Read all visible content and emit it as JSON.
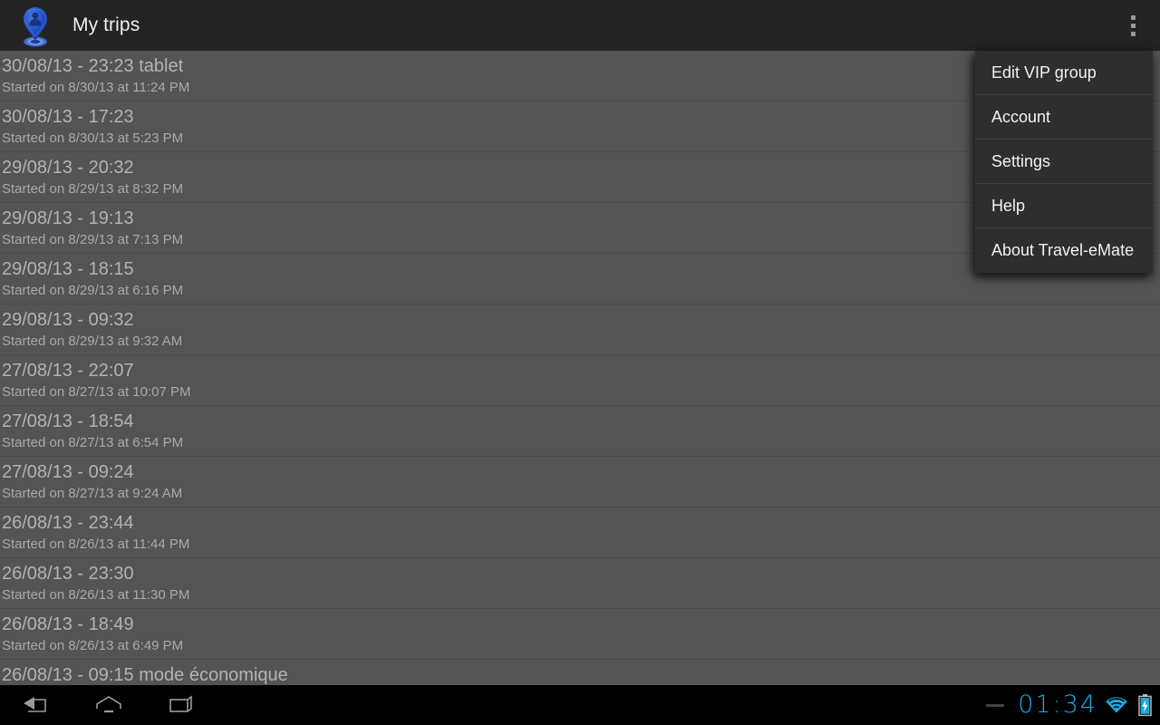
{
  "action_bar": {
    "title": "My trips",
    "app_icon": "map-pin-person-icon",
    "overflow_icon": "overflow-menu-icon"
  },
  "overflow_menu": {
    "items": [
      {
        "label": "Edit VIP group"
      },
      {
        "label": "Account"
      },
      {
        "label": "Settings"
      },
      {
        "label": "Help"
      },
      {
        "label": "About Travel-eMate"
      }
    ]
  },
  "trips": [
    {
      "title": "30/08/13 - 23:23 tablet",
      "subtitle": "Started on 8/30/13 at 11:24 PM"
    },
    {
      "title": "30/08/13 - 17:23",
      "subtitle": "Started on 8/30/13 at 5:23 PM"
    },
    {
      "title": "29/08/13 - 20:32",
      "subtitle": "Started on 8/29/13 at 8:32 PM"
    },
    {
      "title": "29/08/13 - 19:13",
      "subtitle": "Started on 8/29/13 at 7:13 PM"
    },
    {
      "title": "29/08/13 - 18:15",
      "subtitle": "Started on 8/29/13 at 6:16 PM"
    },
    {
      "title": "29/08/13 - 09:32",
      "subtitle": "Started on 8/29/13 at 9:32 AM"
    },
    {
      "title": "27/08/13 - 22:07",
      "subtitle": "Started on 8/27/13 at 10:07 PM"
    },
    {
      "title": "27/08/13 - 18:54",
      "subtitle": "Started on 8/27/13 at 6:54 PM"
    },
    {
      "title": "27/08/13 - 09:24",
      "subtitle": "Started on 8/27/13 at 9:24 AM"
    },
    {
      "title": "26/08/13 - 23:44",
      "subtitle": "Started on 8/26/13 at 11:44 PM"
    },
    {
      "title": "26/08/13 - 23:30",
      "subtitle": "Started on 8/26/13 at 11:30 PM"
    },
    {
      "title": "26/08/13 - 18:49",
      "subtitle": "Started on 8/26/13 at 6:49 PM"
    },
    {
      "title": "26/08/13 - 09:15 mode économique",
      "subtitle": ""
    }
  ],
  "nav_bar": {
    "back_icon": "back-arrow-icon",
    "home_icon": "home-icon",
    "recents_icon": "recent-apps-icon"
  },
  "status_bar": {
    "clock": "01:34",
    "wifi_icon": "wifi-icon",
    "battery_icon": "battery-charging-icon",
    "accent_color": "#1ba8e0"
  }
}
